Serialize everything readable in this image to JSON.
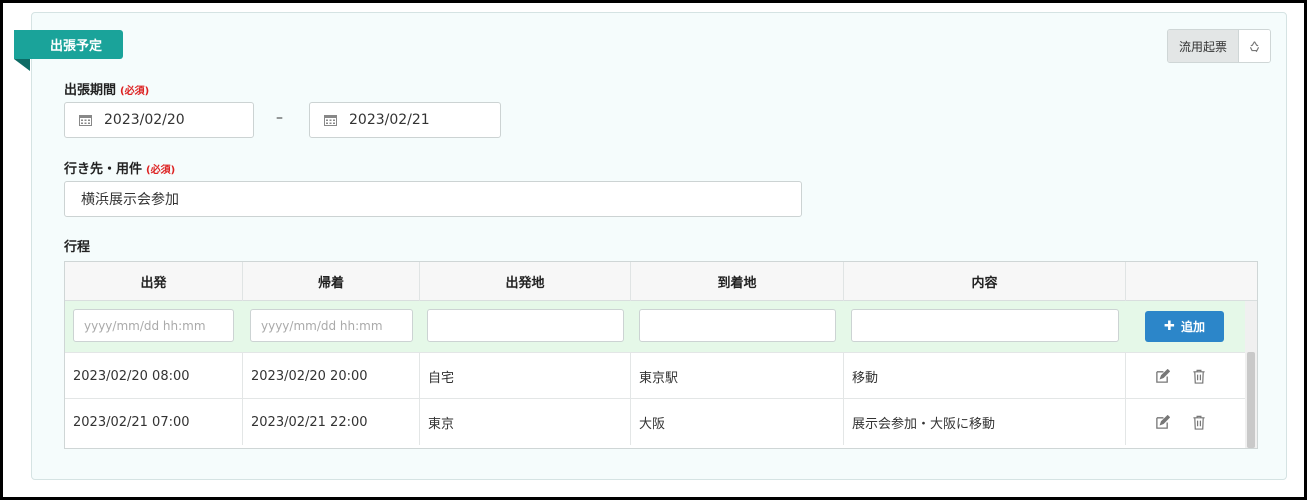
{
  "section": {
    "title": "出張予定",
    "copy_button": "流用起票",
    "recycle_icon": "recycle-icon"
  },
  "period": {
    "label": "出張期間",
    "required": "(必須)",
    "start": "2023/02/20",
    "separator": "–",
    "end": "2023/02/21"
  },
  "destination": {
    "label": "行き先・用件",
    "required": "(必須)",
    "value": "横浜展示会参加"
  },
  "itinerary": {
    "label": "行程",
    "columns": [
      "出発",
      "帰着",
      "出発地",
      "到着地",
      "内容",
      ""
    ],
    "new_row": {
      "depart_placeholder": "yyyy/mm/dd hh:mm",
      "return_placeholder": "yyyy/mm/dd hh:mm",
      "from": "",
      "to": "",
      "content": "",
      "add_label": "追加"
    },
    "rows": [
      {
        "depart": "2023/02/20 08:00",
        "return": "2023/02/20 20:00",
        "from": "自宅",
        "to": "東京駅",
        "content": "移動"
      },
      {
        "depart": "2023/02/21 07:00",
        "return": "2023/02/21 22:00",
        "from": "東京",
        "to": "大阪",
        "content": "展示会参加・大阪に移動"
      }
    ]
  },
  "colors": {
    "ribbon": "#1aa39a",
    "panel_bg": "#f5fcfc",
    "input_row_bg": "#e5f8e8",
    "add_button": "#2c86c9",
    "required": "#dd2222"
  }
}
